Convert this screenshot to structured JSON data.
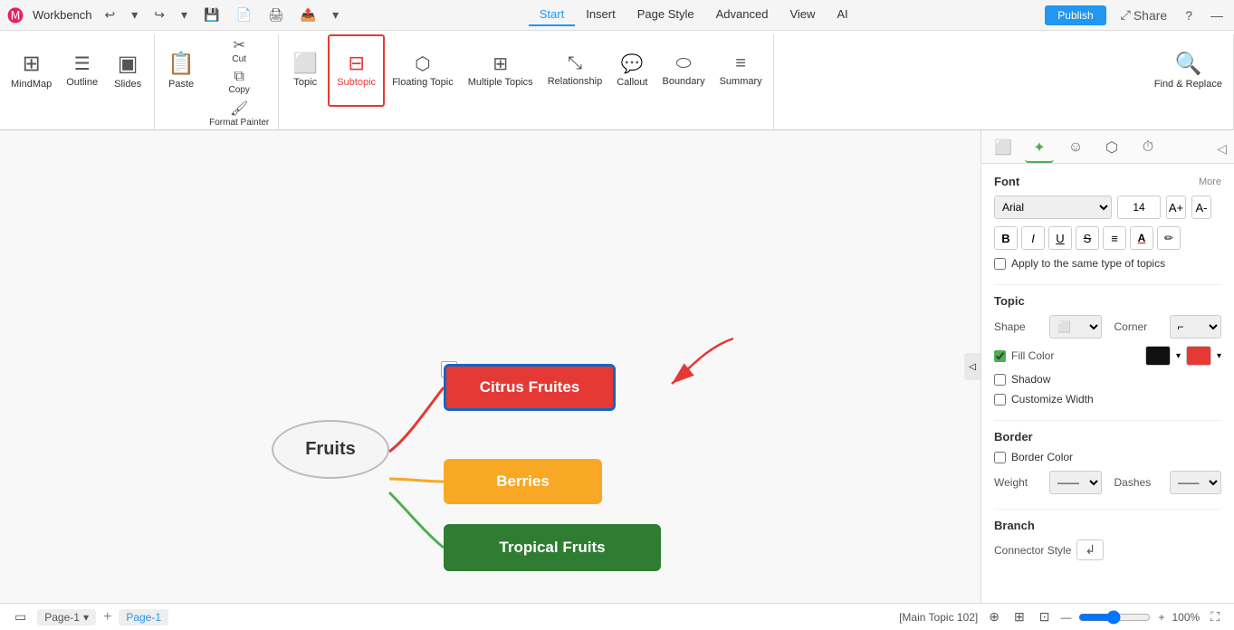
{
  "app": {
    "title": "Workbench",
    "logo": "🅼"
  },
  "titlebar": {
    "undo": "↩",
    "redo": "↪",
    "save": "💾",
    "new": "📄",
    "export": "📤",
    "nav_tabs": [
      "Start",
      "Insert",
      "Page Style",
      "Advanced",
      "View",
      "AI"
    ],
    "active_tab": "Start",
    "publish_label": "Publish",
    "share_label": "Share",
    "help": "?"
  },
  "ribbon": {
    "view_group": [
      {
        "id": "mindmap",
        "icon": "⊞",
        "label": "MindMap"
      },
      {
        "id": "outline",
        "icon": "☰",
        "label": "Outline"
      },
      {
        "id": "slides",
        "icon": "▣",
        "label": "Slides"
      }
    ],
    "edit_group": [
      {
        "id": "paste",
        "icon": "📋",
        "label": "Paste"
      },
      {
        "id": "cut",
        "icon": "✂",
        "label": "Cut"
      },
      {
        "id": "copy",
        "icon": "⧉",
        "label": "Copy"
      },
      {
        "id": "format_painter",
        "icon": "🖌",
        "label": "Format Painter"
      }
    ],
    "insert_group": [
      {
        "id": "topic",
        "icon": "⬜",
        "label": "Topic"
      },
      {
        "id": "subtopic",
        "icon": "⊟",
        "label": "Subtopic"
      },
      {
        "id": "floating_topic",
        "icon": "⬡",
        "label": "Floating Topic"
      },
      {
        "id": "multiple_topics",
        "icon": "⊞",
        "label": "Multiple Topics"
      },
      {
        "id": "relationship",
        "icon": "⤡",
        "label": "Relationship"
      },
      {
        "id": "callout",
        "icon": "💬",
        "label": "Callout"
      },
      {
        "id": "boundary",
        "icon": "⬭",
        "label": "Boundary"
      },
      {
        "id": "summary",
        "icon": "≡",
        "label": "Summary"
      }
    ],
    "find_replace": {
      "icon": "🔍",
      "label": "Find & Replace"
    }
  },
  "canvas": {
    "nodes": {
      "fruits": {
        "label": "Fruits"
      },
      "citrus": {
        "label": "Citrus Fruites"
      },
      "berries": {
        "label": "Berries"
      },
      "tropical": {
        "label": "Tropical Fruits"
      }
    }
  },
  "right_panel": {
    "tabs": [
      {
        "id": "shape",
        "icon": "⬜"
      },
      {
        "id": "ai",
        "icon": "✦"
      },
      {
        "id": "emoji",
        "icon": "☺"
      },
      {
        "id": "sticker",
        "icon": "⬡"
      },
      {
        "id": "clock",
        "icon": "⏱"
      }
    ],
    "active_tab": "ai",
    "font_section": {
      "title": "Font",
      "more": "More",
      "family": "Arial",
      "size": "14",
      "size_up": "A+",
      "size_down": "A-",
      "bold": "B",
      "italic": "I",
      "underline": "U",
      "strikethrough": "S",
      "align": "≡",
      "font_color": "A",
      "highlight": "✏"
    },
    "apply_checkbox": {
      "label": "Apply to the same type of topics"
    },
    "topic_section": {
      "title": "Topic",
      "shape_label": "Shape",
      "corner_label": "Corner",
      "fill_color_label": "Fill Color",
      "shadow_label": "Shadow",
      "customize_width_label": "Customize Width"
    },
    "border_section": {
      "title": "Border",
      "border_color_label": "Border Color",
      "weight_label": "Weight",
      "dashes_label": "Dashes"
    },
    "branch_section": {
      "title": "Branch",
      "connector_style_label": "Connector Style"
    }
  },
  "statusbar": {
    "page_label": "Page-1",
    "active_page": "Page-1",
    "topic_info": "[Main Topic 102]",
    "zoom": "100%"
  }
}
